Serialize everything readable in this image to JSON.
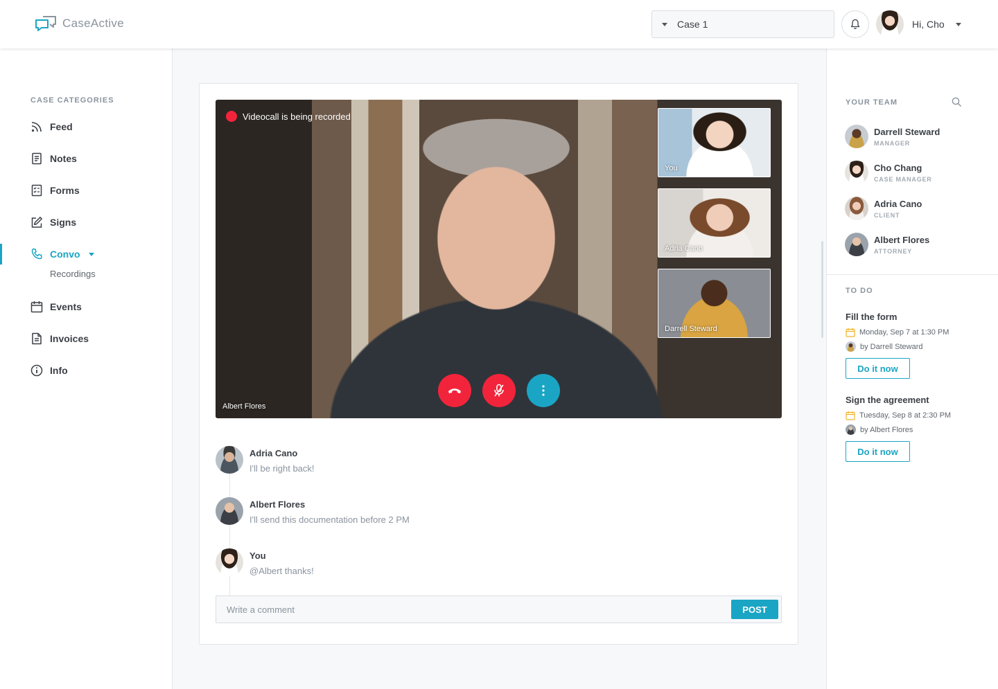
{
  "header": {
    "app_name": "CaseActive",
    "case_selector": "Case 1",
    "greeting": "Hi, Cho"
  },
  "sidebar": {
    "section_label": "CASE CATEGORIES",
    "items": [
      {
        "label": "Feed",
        "icon": "rss-icon"
      },
      {
        "label": "Notes",
        "icon": "document-icon"
      },
      {
        "label": "Forms",
        "icon": "checklist-icon"
      },
      {
        "label": "Signs",
        "icon": "edit-icon"
      },
      {
        "label": "Convo",
        "icon": "phone-icon",
        "active": true
      },
      {
        "label": "Events",
        "icon": "calendar-icon"
      },
      {
        "label": "Invoices",
        "icon": "invoice-icon"
      },
      {
        "label": "Info",
        "icon": "info-icon"
      }
    ],
    "sub_item": "Recordings"
  },
  "video": {
    "recording_text": "Videocall is being recorded",
    "speaker": "Albert Flores",
    "participants": [
      {
        "label": "You"
      },
      {
        "label": "Adria Cano"
      },
      {
        "label": "Darrell Steward"
      }
    ],
    "colors": {
      "danger": "#f2243b",
      "accent": "#1aa5c4"
    }
  },
  "comments": [
    {
      "author": "Adria Cano",
      "text": "I'll be right back!"
    },
    {
      "author": "Albert Flores",
      "text": "I'll send this documentation before 2 PM"
    },
    {
      "author": "You",
      "text": "@Albert thanks!"
    }
  ],
  "comment_box": {
    "placeholder": "Write a comment",
    "post_label": "POST"
  },
  "team": {
    "label": "YOUR TEAM",
    "members": [
      {
        "name": "Darrell Steward",
        "role": "MANAGER"
      },
      {
        "name": "Cho Chang",
        "role": "CASE MANAGER"
      },
      {
        "name": "Adria Cano",
        "role": "CLIENT"
      },
      {
        "name": "Albert Flores",
        "role": "ATTORNEY"
      }
    ]
  },
  "todo": {
    "label": "TO DO",
    "items": [
      {
        "title": "Fill the form",
        "date": "Monday, Sep 7 at 1:30 PM",
        "by": "by Darrell Steward",
        "action": "Do it now"
      },
      {
        "title": "Sign the agreement",
        "date": "Tuesday, Sep 8 at 2:30 PM",
        "by": "by Albert Flores",
        "action": "Do it now"
      }
    ]
  }
}
